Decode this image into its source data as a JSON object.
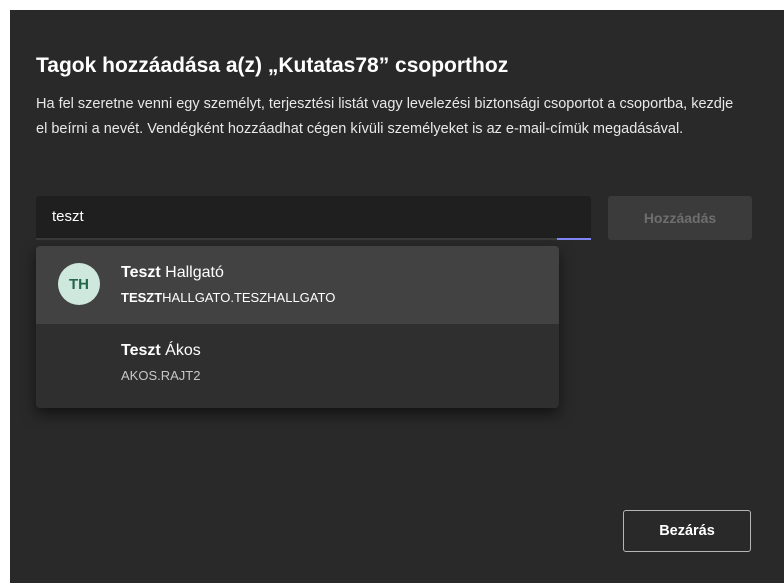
{
  "dialog": {
    "title": "Tagok hozzáadása a(z) „Kutatas78” csoporthoz",
    "description": "Ha fel szeretne venni egy személyt, terjesztési listát vagy levelezési biztonsági csoportot a csoportba, kezdje el beírni a nevét. Vendégként hozzáadhat cégen kívüli személyeket is az e-mail-címük megadásával."
  },
  "search": {
    "value": "teszt"
  },
  "add_button": {
    "label": "Hozzáadás"
  },
  "suggestions": [
    {
      "initials": "TH",
      "name_match": "Teszt",
      "name_rest": " Hallgató",
      "sub_match": "TESZT",
      "sub_rest": "HALLGATO.TESZHALLGATO"
    },
    {
      "initials": "",
      "name_match": "Teszt",
      "name_rest": " Ákos",
      "sub_match": "",
      "sub_rest": "AKOS.RAJT2"
    }
  ],
  "close_button": {
    "label": "Bezárás"
  },
  "colors": {
    "dialog_bg": "#292929",
    "accent": "#7f85f5",
    "avatar_bg": "#cfe8dd",
    "avatar_text": "#24664a"
  }
}
